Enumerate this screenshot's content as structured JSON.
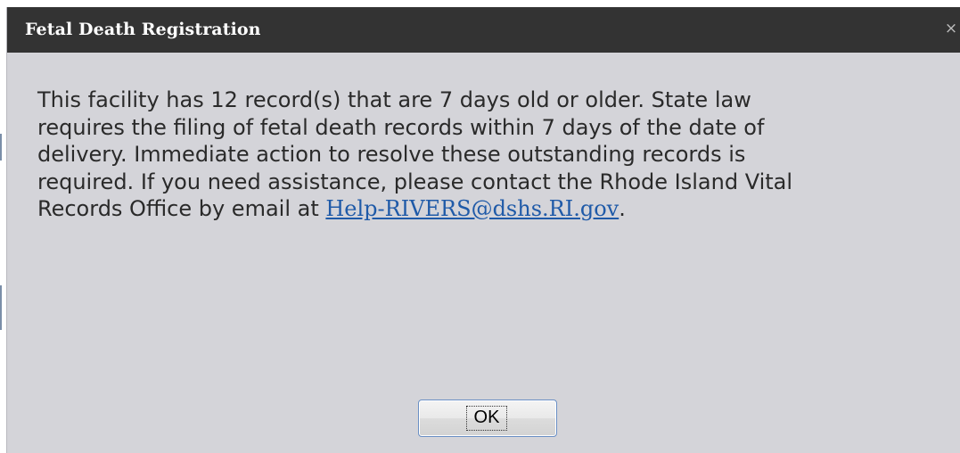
{
  "dialog": {
    "title": "Fetal Death Registration",
    "close_glyph": "×",
    "message_lines": [
      "This facility has 12 record(s) that are 7 days old or older. State law",
      "requires the filing of fetal death records within 7 days of the date of",
      "delivery. Immediate action to resolve these outstanding records is",
      "required. If you need assistance, please contact the Rhode Island Vital"
    ],
    "message_last_prefix": "Records Office by email at ",
    "email_link": "Help-RIVERS@dshs.RI.gov",
    "message_last_suffix": ".",
    "ok_label": "OK"
  },
  "colors": {
    "titlebar_bg": "#333333",
    "dialog_bg": "#d4d4d9",
    "link": "#1f5aa8"
  },
  "icons": {
    "close": "close-icon"
  }
}
